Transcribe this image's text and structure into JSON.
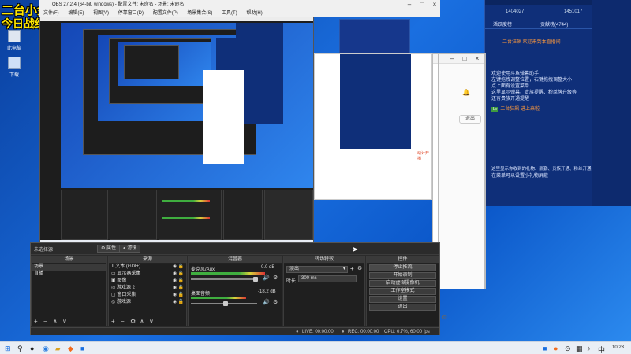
{
  "overlay": {
    "line1": "二台小金",
    "line2": "今日战绩："
  },
  "desktop": {
    "icons": [
      {
        "name": "此电脑"
      },
      {
        "name": "下载"
      }
    ]
  },
  "chat_panel": {
    "header_left": "1404027",
    "header_right": "1451017",
    "tabs": [
      "活跃度榜",
      "贡献榜(4744)"
    ],
    "lines": [
      "二台狂飙   欢迎来到本直播间",
      "欢迎使用斗鱼弹幕助手",
      "左键拖拽调整位置，右键拖拽调整大小",
      "点上面有设置菜单",
      "这里显示弹幕、贵族提醒、粉丝牌升级等",
      "还有贵族开通提醒",
      "二台狂飙  进上来啦",
      "这里显示你收到的礼物、酬勤、贵族开通、粉丝开通",
      "在菜单可以设置小礼物屏蔽"
    ]
  },
  "white_app": {
    "button": "退出",
    "link": "动计开播"
  },
  "obs": {
    "title": "OBS 27.2.4 (64-bit, windows) - 配置文件: 未命名 - 场景: 未命名",
    "menu": [
      "文件(F)",
      "编辑(E)",
      "视图(V)",
      "停靠窗口(D)",
      "配置文件(P)",
      "场景集合(S)",
      "工具(T)",
      "帮助(H)"
    ],
    "preview_label": "未选择源",
    "props_btn": "属性",
    "filters_btn": "滤镜",
    "docks": {
      "scenes": "场景",
      "sources": "来源",
      "mixer": "混音器",
      "transitions": "转场特效",
      "controls": "控件"
    },
    "scenes": [
      "场景",
      "直播"
    ],
    "sources": [
      "文本 (GDI+)",
      "显示器采集",
      "图像",
      "游戏源 2",
      "窗口采集",
      "游戏源"
    ],
    "mixer": [
      {
        "name": "麦克风/Aux",
        "db": "0.0 dB"
      },
      {
        "name": "桌面音频",
        "db": "-18.2 dB"
      }
    ],
    "transition": {
      "type": "淡出",
      "duration_label": "时长",
      "duration_value": "300 ms"
    },
    "controls": [
      "停止推流",
      "开始录制",
      "启动虚拟摄像机",
      "工作室模式",
      "设置",
      "退出"
    ],
    "status": {
      "live": "LIVE: 00:00:00",
      "rec": "REC: 00:00:00",
      "cpu": "CPU: 0.7%, 60.00 fps"
    }
  },
  "taskbar": {
    "time": "10:23"
  },
  "colors": {
    "overlay_yellow": "#ffe600",
    "chat_bg": "#0f2f79",
    "obs_bg": "#2b2b2b",
    "desktop_blue": "#1a6fe0"
  }
}
